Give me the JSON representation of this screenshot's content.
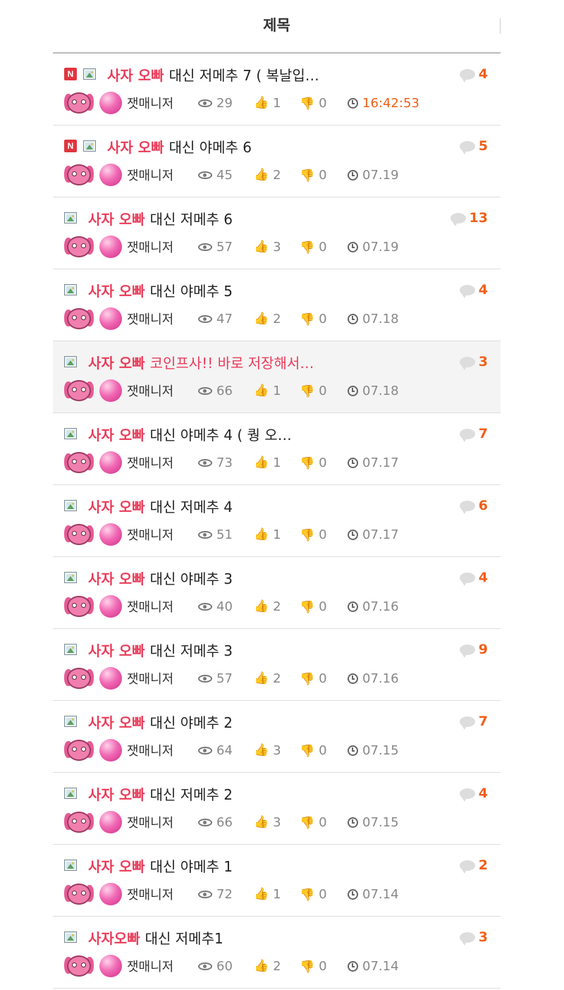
{
  "header": {
    "title": "제목"
  },
  "posts": [
    {
      "badge_n": true,
      "prefix": "사자 오빠",
      "title": "대신 저메추 7 ( 복날입…",
      "title_red": false,
      "comments": "4",
      "author": "잿매니저",
      "views": "29",
      "likes": "1",
      "dislikes": "0",
      "time": "16:42:53",
      "time_today": true,
      "highlighted": false
    },
    {
      "badge_n": true,
      "prefix": "사자 오빠",
      "title": "대신 야메추 6",
      "title_red": false,
      "comments": "5",
      "author": "잿매니저",
      "views": "45",
      "likes": "2",
      "dislikes": "0",
      "time": "07.19",
      "time_today": false,
      "highlighted": false
    },
    {
      "badge_n": false,
      "prefix": "사자 오빠",
      "title": "대신 저메추 6",
      "title_red": false,
      "comments": "13",
      "author": "잿매니저",
      "views": "57",
      "likes": "3",
      "dislikes": "0",
      "time": "07.19",
      "time_today": false,
      "highlighted": false
    },
    {
      "badge_n": false,
      "prefix": "사자 오빠",
      "title": "대신 야메추 5",
      "title_red": false,
      "comments": "4",
      "author": "잿매니저",
      "views": "47",
      "likes": "2",
      "dislikes": "0",
      "time": "07.18",
      "time_today": false,
      "highlighted": false
    },
    {
      "badge_n": false,
      "prefix": "사자 오빠",
      "title": "코인프사!! 바로 저장해서…",
      "title_red": true,
      "comments": "3",
      "author": "잿매니저",
      "views": "66",
      "likes": "1",
      "dislikes": "0",
      "time": "07.18",
      "time_today": false,
      "highlighted": true
    },
    {
      "badge_n": false,
      "prefix": "사자 오빠",
      "title": "대신 야메추 4 ( 퀑 오…",
      "title_red": false,
      "comments": "7",
      "author": "잿매니저",
      "views": "73",
      "likes": "1",
      "dislikes": "0",
      "time": "07.17",
      "time_today": false,
      "highlighted": false
    },
    {
      "badge_n": false,
      "prefix": "사자 오빠",
      "title": "대신 저메추 4",
      "title_red": false,
      "comments": "6",
      "author": "잿매니저",
      "views": "51",
      "likes": "1",
      "dislikes": "0",
      "time": "07.17",
      "time_today": false,
      "highlighted": false
    },
    {
      "badge_n": false,
      "prefix": "사자 오빠",
      "title": "대신 야메추 3",
      "title_red": false,
      "comments": "4",
      "author": "잿매니저",
      "views": "40",
      "likes": "2",
      "dislikes": "0",
      "time": "07.16",
      "time_today": false,
      "highlighted": false
    },
    {
      "badge_n": false,
      "prefix": "사자 오빠",
      "title": "대신 저메추 3",
      "title_red": false,
      "comments": "9",
      "author": "잿매니저",
      "views": "57",
      "likes": "2",
      "dislikes": "0",
      "time": "07.16",
      "time_today": false,
      "highlighted": false
    },
    {
      "badge_n": false,
      "prefix": "사자 오빠",
      "title": "대신 야메추 2",
      "title_red": false,
      "comments": "7",
      "author": "잿매니저",
      "views": "64",
      "likes": "3",
      "dislikes": "0",
      "time": "07.15",
      "time_today": false,
      "highlighted": false
    },
    {
      "badge_n": false,
      "prefix": "사자 오빠",
      "title": "대신 저메추 2",
      "title_red": false,
      "comments": "4",
      "author": "잿매니저",
      "views": "66",
      "likes": "3",
      "dislikes": "0",
      "time": "07.15",
      "time_today": false,
      "highlighted": false
    },
    {
      "badge_n": false,
      "prefix": "사자 오빠",
      "title": "대신 야메추 1",
      "title_red": false,
      "comments": "2",
      "author": "잿매니저",
      "views": "72",
      "likes": "1",
      "dislikes": "0",
      "time": "07.14",
      "time_today": false,
      "highlighted": false
    },
    {
      "badge_n": false,
      "prefix": "사자오빠",
      "title": "대신 저메추1",
      "title_red": false,
      "comments": "3",
      "author": "잿매니저",
      "views": "60",
      "likes": "2",
      "dislikes": "0",
      "time": "07.14",
      "time_today": false,
      "highlighted": false
    }
  ],
  "icons": {
    "new_badge": "N",
    "image": "image-icon",
    "comment": "comment-bubble-icon",
    "views": "eye-icon",
    "likes": "thumbs-up-icon",
    "dislikes": "thumbs-down-icon",
    "time": "clock-icon"
  },
  "colors": {
    "prefix": "#e93c5a",
    "comment_count": "#f0601a",
    "today_time": "#f0601a"
  }
}
